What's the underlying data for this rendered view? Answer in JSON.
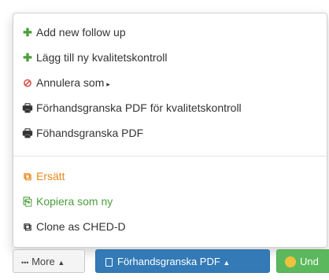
{
  "menu": {
    "items": [
      {
        "icon": "plus-icon",
        "glyph": "✚",
        "label": "Add new follow up"
      },
      {
        "icon": "plus-icon",
        "glyph": "✚",
        "label": "Lägg till ny kvalitetskontroll"
      },
      {
        "icon": "ban-icon",
        "glyph": "⊘",
        "label": "Annulera som"
      },
      {
        "icon": "print-icon",
        "glyph": "🖶",
        "label": "Förhandsgranska PDF för kvalitetskontroll"
      },
      {
        "icon": "print-icon",
        "glyph": "🖶",
        "label": "Föhandsgranska PDF"
      },
      {
        "icon": "replace-icon",
        "glyph": "⧉",
        "label": "Ersätt"
      },
      {
        "icon": "copy-icon",
        "glyph": "⎘",
        "label": "Kopiera som ny"
      },
      {
        "icon": "clone-icon",
        "glyph": "⧉",
        "label": "Clone as CHED-D"
      }
    ],
    "submenu_caret": "▸"
  },
  "buttons": {
    "more": {
      "label": "More",
      "prefix": "•••",
      "caret": "▲"
    },
    "pdf": {
      "label": "Förhandsgranska PDF",
      "caret": "▲"
    },
    "und": {
      "label": "Und"
    }
  },
  "colors": {
    "green": "#4b9e3c",
    "red": "#d9534f",
    "orange": "#e8891a",
    "blue": "#337ab7"
  }
}
